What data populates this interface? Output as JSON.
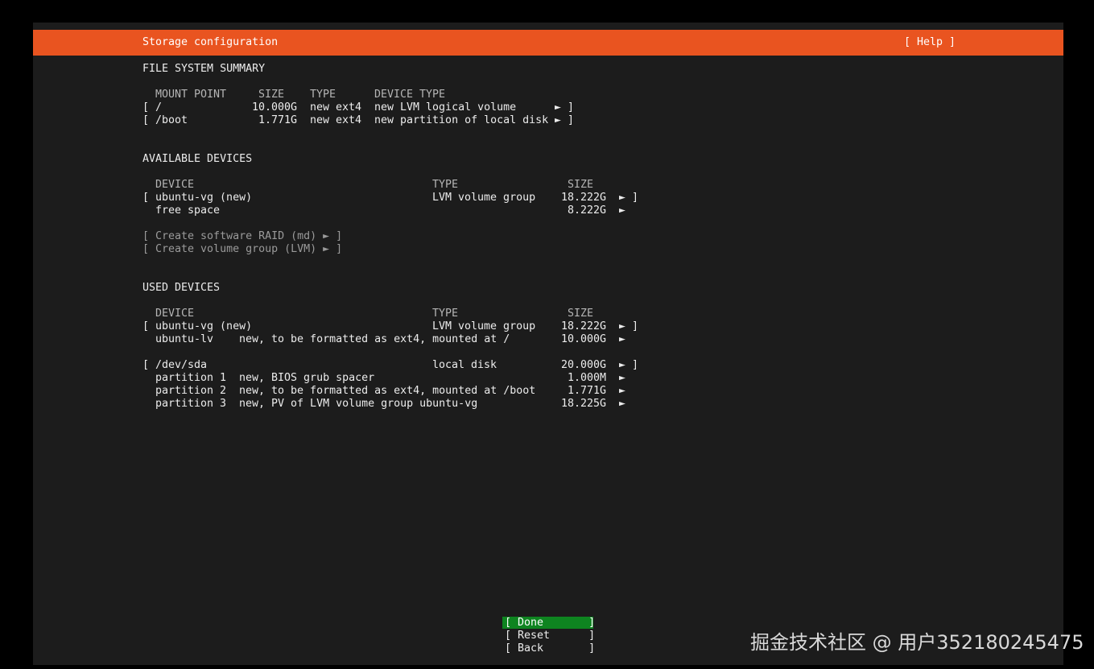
{
  "header": {
    "title": "Storage configuration",
    "help": "[ Help ]"
  },
  "fs_summary": {
    "heading": "FILE SYSTEM SUMMARY",
    "columns": [
      "MOUNT POINT",
      "SIZE",
      "TYPE",
      "DEVICE TYPE"
    ],
    "rows": [
      {
        "open": "[",
        "mount": "/",
        "size": "10.000G",
        "type": "new ext4",
        "device_type": "new LVM logical volume",
        "arrow": "►",
        "close": "]"
      },
      {
        "open": "[",
        "mount": "/boot",
        "size": "1.771G",
        "type": "new ext4",
        "device_type": "new partition of local disk",
        "arrow": "►",
        "close": "]"
      }
    ]
  },
  "available": {
    "heading": "AVAILABLE DEVICES",
    "columns": [
      "DEVICE",
      "TYPE",
      "SIZE"
    ],
    "rows": [
      {
        "open": "[",
        "device": "ubuntu-vg (new)",
        "type": "LVM volume group",
        "size": "18.222G",
        "arrow": "►",
        "close": "]"
      },
      {
        "device": "free space",
        "size": "8.222G",
        "arrow": "►"
      }
    ],
    "actions": [
      "[ Create software RAID (md) ► ]",
      "[ Create volume group (LVM) ► ]"
    ]
  },
  "used": {
    "heading": "USED DEVICES",
    "columns": [
      "DEVICE",
      "TYPE",
      "SIZE"
    ],
    "rows": [
      {
        "open": "[",
        "device": "ubuntu-vg (new)",
        "type": "LVM volume group",
        "size": "18.222G",
        "arrow": "►",
        "close": "]"
      },
      {
        "device": "ubuntu-lv",
        "desc": "new, to be formatted as ext4, mounted at /",
        "size": "10.000G",
        "arrow": "►"
      },
      {
        "open": "[",
        "device": "/dev/sda",
        "type": "local disk",
        "size": "20.000G",
        "arrow": "►",
        "close": "]"
      },
      {
        "device": "partition 1",
        "desc": "new, BIOS grub spacer",
        "size": "1.000M",
        "arrow": "►"
      },
      {
        "device": "partition 2",
        "desc": "new, to be formatted as ext4, mounted at /boot",
        "size": "1.771G",
        "arrow": "►"
      },
      {
        "device": "partition 3",
        "desc": "new, PV of LVM volume group ubuntu-vg",
        "size": "18.225G",
        "arrow": "►"
      }
    ]
  },
  "buttons": {
    "done": "[ Done       ]",
    "reset": "[ Reset      ]",
    "back": "[ Back       ]"
  },
  "watermark": "掘金技术社区 @ 用户352180245475",
  "colors": {
    "titlebar": "#e95420",
    "screen": "#1c1c1c",
    "selected": "#0e8420"
  }
}
